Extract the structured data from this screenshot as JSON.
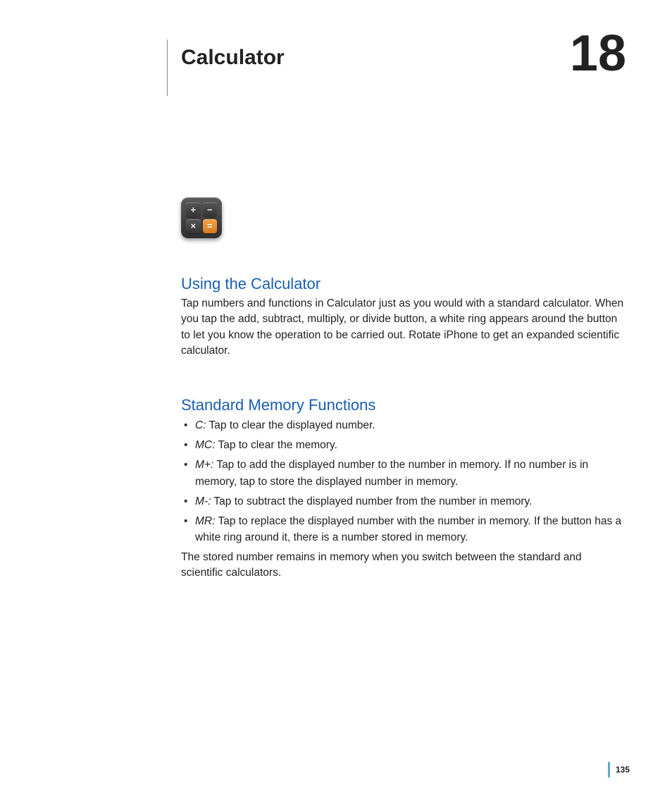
{
  "chapter": {
    "title": "Calculator",
    "number": "18"
  },
  "icon": {
    "buttons": [
      "+",
      "−",
      "×",
      "="
    ]
  },
  "sections": {
    "using": {
      "heading": "Using the Calculator",
      "body": "Tap numbers and functions in Calculator just as you would with a standard calculator. When you tap the add, subtract, multiply, or divide button, a white ring appears around the button to let you know the operation to be carried out. Rotate iPhone to get an expanded scientific calculator."
    },
    "memory": {
      "heading": "Standard Memory Functions",
      "items": [
        {
          "label": "C:",
          "desc": "Tap to clear the displayed number."
        },
        {
          "label": "MC:",
          "desc": "Tap to clear the memory."
        },
        {
          "label": "M+:",
          "desc": "Tap to add the displayed number to the number in memory. If no number is in memory, tap to store the displayed number in memory."
        },
        {
          "label": "M-:",
          "desc": "Tap to subtract the displayed number from the number in memory."
        },
        {
          "label": "MR:",
          "desc": "Tap to replace the displayed number with the number in memory. If the button has a white ring around it, there is a number stored in memory."
        }
      ],
      "closing": "The stored number remains in memory when you switch between the standard and scientific calculators."
    }
  },
  "footer": {
    "page_number": "135"
  }
}
